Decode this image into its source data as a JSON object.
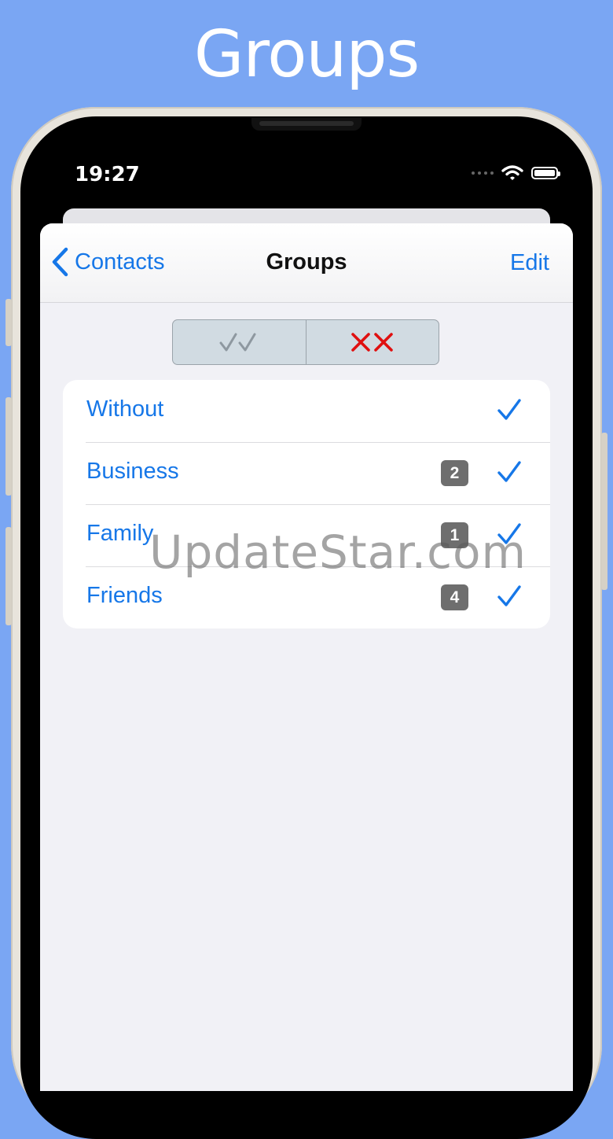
{
  "promo": {
    "title": "Groups"
  },
  "status_bar": {
    "time": "19:27",
    "icons": [
      "cellular-dots-icon",
      "wifi-icon",
      "battery-icon"
    ]
  },
  "navbar": {
    "back_label": "Contacts",
    "title": "Groups",
    "edit_label": "Edit"
  },
  "segmented_control": {
    "segments": [
      {
        "name": "select-all",
        "icon": "double-check-icon",
        "color": "#8e98a0"
      },
      {
        "name": "deselect-all",
        "icon": "double-cross-icon",
        "color": "#e01010"
      }
    ]
  },
  "groups": [
    {
      "label": "Without",
      "count": null,
      "checked": true
    },
    {
      "label": "Business",
      "count": "2",
      "checked": true
    },
    {
      "label": "Family",
      "count": "1",
      "checked": true
    },
    {
      "label": "Friends",
      "count": "4",
      "checked": true
    }
  ],
  "watermark": "UpdateStar.com",
  "colors": {
    "background": "#7aa6f3",
    "accent": "#1677e8",
    "badge": "#6e6e6e",
    "cross": "#e01010"
  }
}
